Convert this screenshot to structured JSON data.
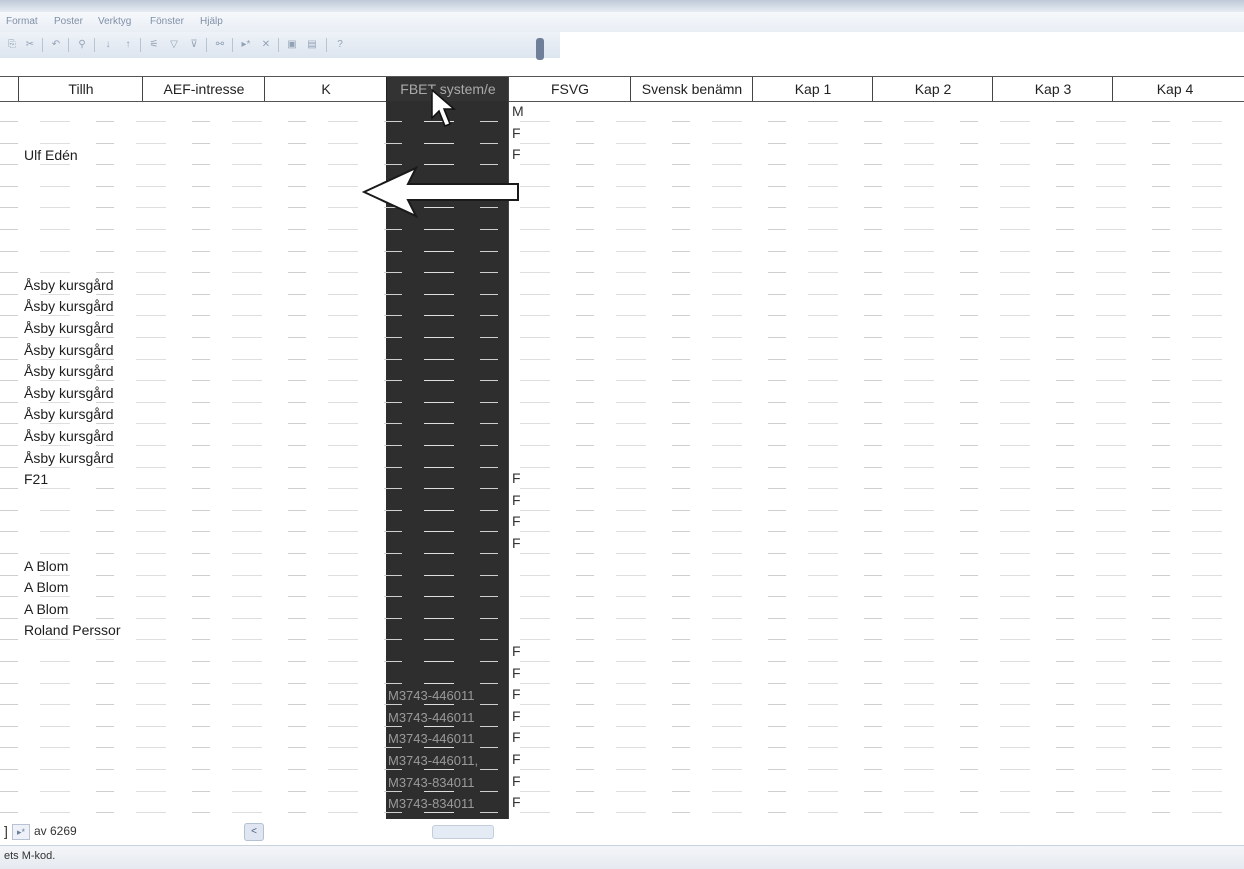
{
  "menu": [
    "Format",
    "Poster",
    "Verktyg",
    "Fönster",
    "Hjälp"
  ],
  "toolbar_icons": [
    "copy-icon",
    "cut-icon",
    "undo-icon",
    "find-icon",
    "sort-asc-icon",
    "sort-desc-icon",
    "filter-icon",
    "filter-selection-icon",
    "apply-filter-icon",
    "binoculars-icon",
    "new-record-icon",
    "delete-record-icon",
    "window-icon",
    "options-icon",
    "help-icon"
  ],
  "columns": [
    "Tillh",
    "AEF-intresse",
    "K",
    "FBET system/e",
    "FSVG",
    "Svensk benämn",
    "Kap 1",
    "Kap 2",
    "Kap 3",
    "Kap 4"
  ],
  "rows": [
    {
      "tillh": "",
      "code": "",
      "flag": "M"
    },
    {
      "tillh": "",
      "code": "",
      "flag": "F"
    },
    {
      "tillh": "Ulf Edén",
      "code": "",
      "flag": "F"
    },
    {
      "tillh": "",
      "code": "",
      "flag": ""
    },
    {
      "tillh": "",
      "code": "",
      "flag": ""
    },
    {
      "tillh": "",
      "code": "",
      "flag": ""
    },
    {
      "tillh": "",
      "code": "",
      "flag": ""
    },
    {
      "tillh": "",
      "code": "",
      "flag": ""
    },
    {
      "tillh": "Åsby kursgård",
      "code": "",
      "flag": ""
    },
    {
      "tillh": "Åsby kursgård",
      "code": "",
      "flag": ""
    },
    {
      "tillh": "Åsby kursgård",
      "code": "",
      "flag": ""
    },
    {
      "tillh": "Åsby kursgård",
      "code": "",
      "flag": ""
    },
    {
      "tillh": "Åsby kursgård",
      "code": "",
      "flag": ""
    },
    {
      "tillh": "Åsby kursgård",
      "code": "",
      "flag": ""
    },
    {
      "tillh": "Åsby kursgård",
      "code": "",
      "flag": ""
    },
    {
      "tillh": "Åsby kursgård",
      "code": "",
      "flag": ""
    },
    {
      "tillh": "Åsby kursgård",
      "code": "",
      "flag": ""
    },
    {
      "tillh": "F21",
      "code": "",
      "flag": "F"
    },
    {
      "tillh": "",
      "code": "",
      "flag": "F"
    },
    {
      "tillh": "",
      "code": "",
      "flag": "F"
    },
    {
      "tillh": "",
      "code": "",
      "flag": "F"
    },
    {
      "tillh": "A Blom",
      "code": "",
      "flag": ""
    },
    {
      "tillh": "A Blom",
      "code": "",
      "flag": ""
    },
    {
      "tillh": "A Blom",
      "code": "",
      "flag": ""
    },
    {
      "tillh": "Roland Perssor",
      "code": "",
      "flag": ""
    },
    {
      "tillh": "",
      "code": "",
      "flag": "F"
    },
    {
      "tillh": "",
      "code": "",
      "flag": "F"
    },
    {
      "tillh": "",
      "code": "M3743-446011",
      "flag": "F"
    },
    {
      "tillh": "",
      "code": "M3743-446011",
      "flag": "F"
    },
    {
      "tillh": "",
      "code": "M3743-446011",
      "flag": "F"
    },
    {
      "tillh": "",
      "code": "M3743-446011,",
      "flag": "F"
    },
    {
      "tillh": "",
      "code": "M3743-834011",
      "flag": "F"
    },
    {
      "tillh": "",
      "code": "M3743-834011",
      "flag": "F"
    }
  ],
  "navigation": {
    "bracket": "]",
    "next_button": "▸*",
    "record_count": "av 6269",
    "scroll_left": "<"
  },
  "status": {
    "text": "ets M-kod."
  },
  "colors": {
    "selected_column": "#2e2e2e",
    "toolbar": "#e3e9f2",
    "grid_line": "#d0d0d0"
  }
}
